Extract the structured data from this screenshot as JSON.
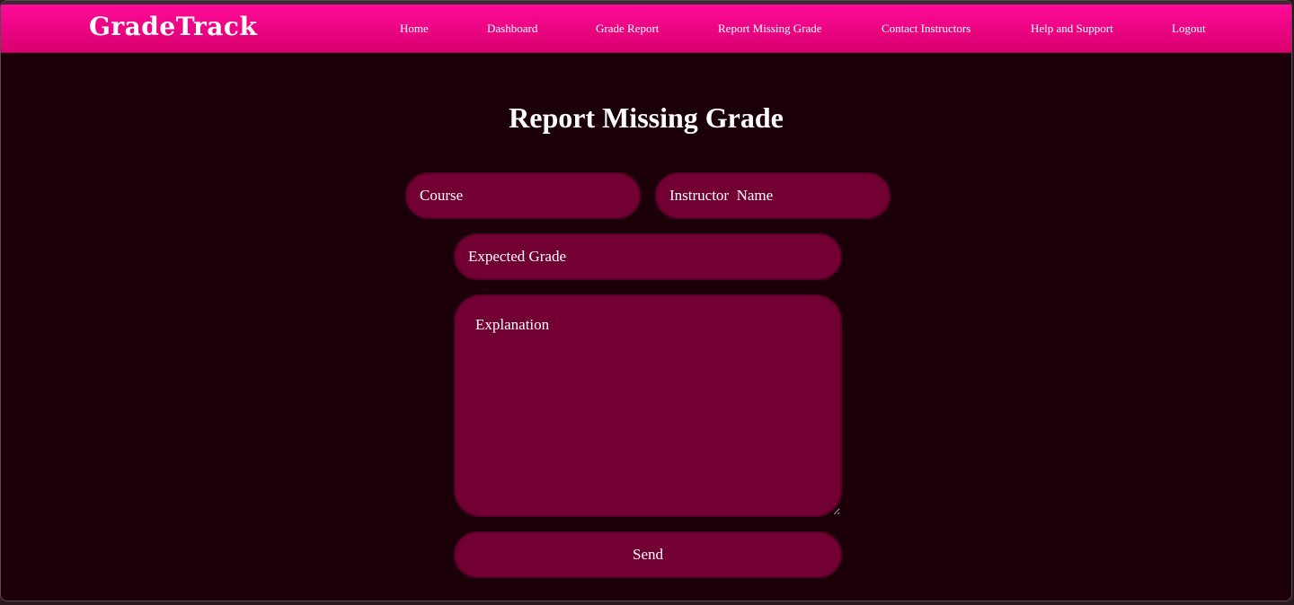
{
  "brand": "GradeTrack",
  "nav": {
    "items": [
      {
        "label": "Home"
      },
      {
        "label": "Dashboard"
      },
      {
        "label": "Grade Report"
      },
      {
        "label": "Report Missing Grade"
      },
      {
        "label": "Contact Instructors"
      },
      {
        "label": "Help and Support"
      },
      {
        "label": "Logout"
      }
    ]
  },
  "page": {
    "title": "Report Missing Grade"
  },
  "form": {
    "course": {
      "placeholder": "Course",
      "value": ""
    },
    "instructor": {
      "placeholder": "Instructor  Name",
      "value": ""
    },
    "expected_grade": {
      "placeholder": "Expected Grade",
      "value": ""
    },
    "explanation": {
      "placeholder": "Explanation",
      "value": ""
    },
    "send_label": "Send"
  },
  "colors": {
    "nav_gradient_top": "#ff0a99",
    "nav_gradient_bottom": "#d8006e",
    "background": "#1c0009",
    "field_fill": "#720032",
    "text": "#ffffff"
  }
}
